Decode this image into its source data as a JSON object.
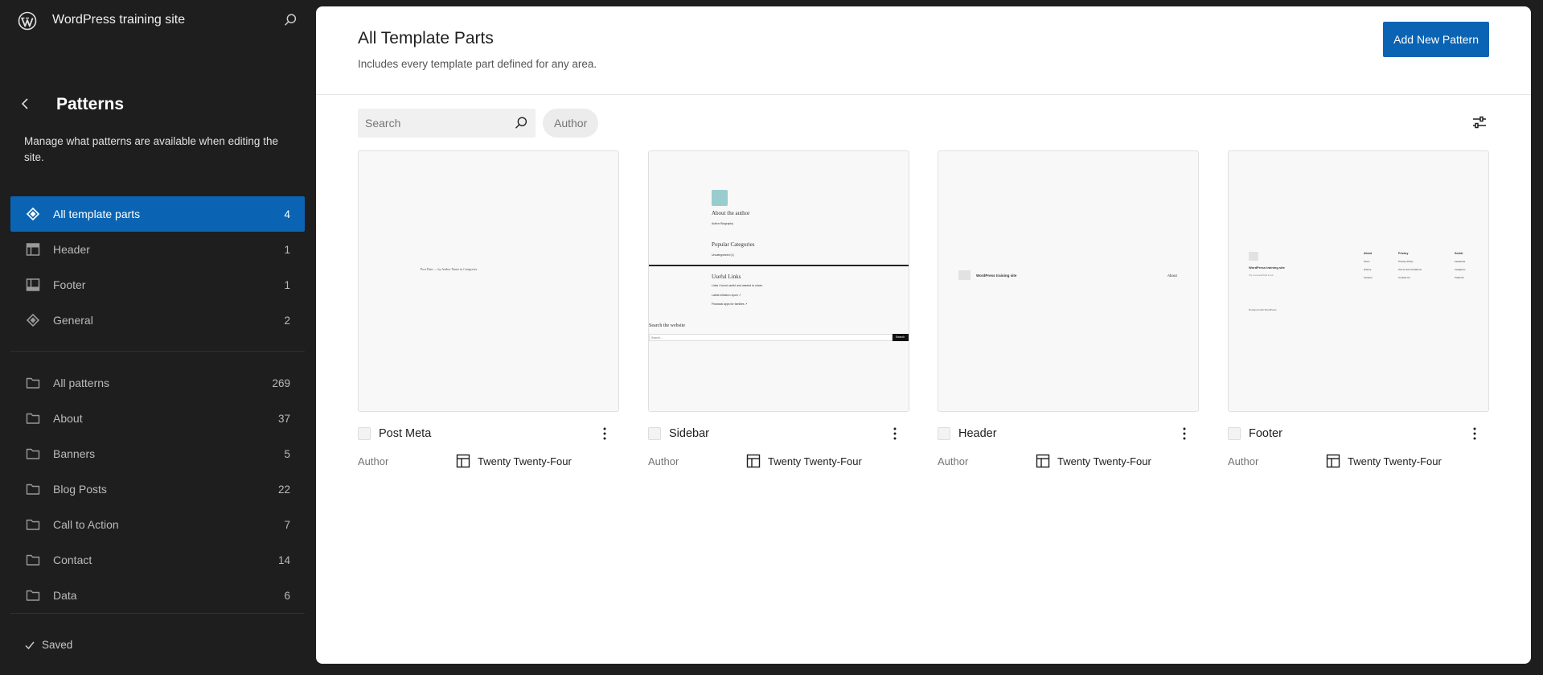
{
  "site": {
    "title": "WordPress training site"
  },
  "sidebar": {
    "title": "Patterns",
    "description": "Manage what patterns are available when editing the site.",
    "template_parts": [
      {
        "label": "All template parts",
        "count": "4",
        "icon": "diamond-icon"
      },
      {
        "label": "Header",
        "count": "1",
        "icon": "header-icon"
      },
      {
        "label": "Footer",
        "count": "1",
        "icon": "footer-icon"
      },
      {
        "label": "General",
        "count": "2",
        "icon": "diamond-icon"
      }
    ],
    "categories": [
      {
        "label": "All patterns",
        "count": "269"
      },
      {
        "label": "About",
        "count": "37"
      },
      {
        "label": "Banners",
        "count": "5"
      },
      {
        "label": "Blog Posts",
        "count": "22"
      },
      {
        "label": "Call to Action",
        "count": "7"
      },
      {
        "label": "Contact",
        "count": "14"
      },
      {
        "label": "Data",
        "count": "6"
      }
    ],
    "status": "Saved"
  },
  "main": {
    "title": "All Template Parts",
    "description": "Includes every template part defined for any area.",
    "add_button": "Add New Pattern",
    "search_placeholder": "Search",
    "author_filter": "Author",
    "cards": [
      {
        "title": "Post Meta",
        "author_label": "Author",
        "theme": "Twenty Twenty-Four",
        "preview": {
          "line": "Post Date — by Author Name in Categories"
        }
      },
      {
        "title": "Sidebar",
        "author_label": "Author",
        "theme": "Twenty Twenty-Four",
        "preview": {
          "about": "About the author",
          "bio": "Author Biography",
          "popular": "Popular Categories",
          "uncat": "Uncategorized (1)",
          "useful": "Useful Links",
          "useful_desc": "Links I found useful and wanted to share.",
          "link1": "Latest inflation report ↗",
          "link2": "Financial apps for families ↗",
          "search_heading": "Search the website",
          "search_ph": "Search...",
          "search_btn": "Search"
        }
      },
      {
        "title": "Header",
        "author_label": "Author",
        "theme": "Twenty Twenty-Four",
        "preview": {
          "site": "WordPress training site",
          "nav": "About"
        }
      },
      {
        "title": "Footer",
        "author_label": "Author",
        "theme": "Twenty Twenty-Four",
        "preview": {
          "site": "WordPress training site",
          "tagline": "Try it out and find it out",
          "col1_head": "About",
          "col1": [
            "Team",
            "History",
            "Careers"
          ],
          "col2_head": "Privacy",
          "col2": [
            "Privacy Policy",
            "Terms and Conditions",
            "Contact Us"
          ],
          "col3_head": "Social",
          "col3": [
            "Facebook",
            "Instagram",
            "Twitter/X"
          ],
          "credit": "Designed with WordPress"
        }
      }
    ]
  },
  "colors": {
    "accent": "#0a64b3",
    "sidebar_bg": "#1e1e1e"
  }
}
